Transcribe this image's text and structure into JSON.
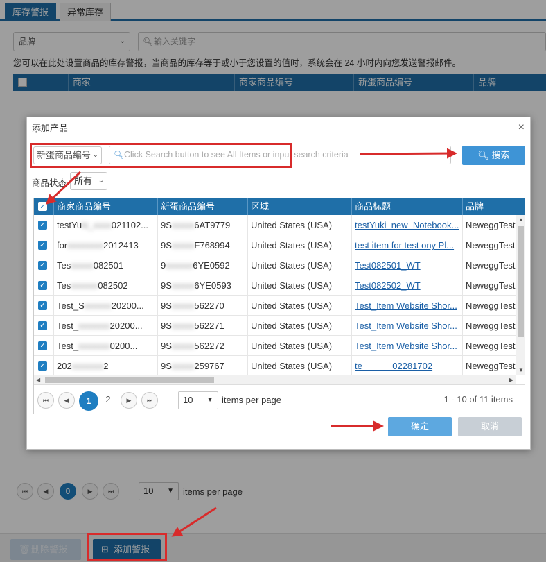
{
  "tabs": [
    {
      "label": "库存警报",
      "active": true
    },
    {
      "label": "异常库存",
      "active": false
    }
  ],
  "filter": {
    "brand_select": "品牌",
    "search_placeholder": "输入关键字"
  },
  "notice": "您可以在此处设置商品的库存警报，当商品的库存等于或小于您设置的值时，系统会在 24 小时内向您发送警报邮件。",
  "bg_table": {
    "columns": [
      "商家",
      "商家商品编号",
      "新蛋商品编号",
      "品牌"
    ]
  },
  "bg_pager": {
    "first": "⏮",
    "prev": "◀",
    "current": "0",
    "next": "▶",
    "last": "⏭",
    "page_size": "10",
    "items_per_page": "items per page"
  },
  "actions": {
    "delete_label": "删除警报",
    "add_label": "添加警报"
  },
  "modal": {
    "title": "添加产品",
    "close": "×",
    "field_select": "新蛋商品编号",
    "search_placeholder": "Click Search button to see All Items or input search criteria",
    "search_button": "搜索",
    "status_label": "商品状态",
    "status_value": "所有",
    "columns": [
      "商家商品编号",
      "新蛋商品编号",
      "区域",
      "商品标题",
      "品牌"
    ],
    "rows": [
      {
        "seller_prefix": "testYu",
        "seller_mid": "ki_xxxx",
        "seller_suffix": "021102...",
        "ne_prefix": "9S",
        "ne_mid": "xxxxx",
        "ne_suffix": "6AT9779",
        "region": "United States (USA)",
        "title": "testYuki_new_Notebook...",
        "brand": "NeweggTest"
      },
      {
        "seller_prefix": "for",
        "seller_mid": "xxxxxxxx",
        "seller_suffix": "2012413",
        "ne_prefix": "9S",
        "ne_mid": "xxxxx",
        "ne_suffix": "F768994",
        "region": "United States (USA)",
        "title": "test item for test ony Pl...",
        "brand": "NeweggTest"
      },
      {
        "seller_prefix": "Tes",
        "seller_mid": "xxxxx",
        "seller_suffix": "082501",
        "ne_prefix": "9",
        "ne_mid": "xxxxxx",
        "ne_suffix": "6YE0592",
        "region": "United States (USA)",
        "title": "Test082501_WT",
        "brand": "NeweggTest"
      },
      {
        "seller_prefix": "Tes",
        "seller_mid": "xxxxxx",
        "seller_suffix": "082502",
        "ne_prefix": "9S",
        "ne_mid": "xxxxx",
        "ne_suffix": "6YE0593",
        "region": "United States (USA)",
        "title": "Test082502_WT",
        "brand": "NeweggTest"
      },
      {
        "seller_prefix": "Test_S",
        "seller_mid": "xxxxxx",
        "seller_suffix": "20200...",
        "ne_prefix": "9S",
        "ne_mid": "xxxxx",
        "ne_suffix": "562270",
        "region": "United States (USA)",
        "title": "Test_Item Website Shor...",
        "brand": "NeweggTest"
      },
      {
        "seller_prefix": "Test_",
        "seller_mid": "xxxxxxx",
        "seller_suffix": "20200...",
        "ne_prefix": "9S",
        "ne_mid": "xxxxx",
        "ne_suffix": "562271",
        "region": "United States (USA)",
        "title": "Test_Item Website Shor...",
        "brand": "NeweggTest"
      },
      {
        "seller_prefix": "Test_",
        "seller_mid": "xxxxxxx",
        "seller_suffix": "0200...",
        "ne_prefix": "9S",
        "ne_mid": "xxxxx",
        "ne_suffix": "562272",
        "region": "United States (USA)",
        "title": "Test_Item Website Shor...",
        "brand": "NeweggTest"
      },
      {
        "seller_prefix": "202",
        "seller_mid": "xxxxxxx",
        "seller_suffix": "2",
        "ne_prefix": "9S",
        "ne_mid": "xxxxx",
        "ne_suffix": "259767",
        "region": "United States (USA)",
        "title": "te______02281702",
        "brand": "NeweggTest"
      }
    ],
    "pager": {
      "first": "⏮",
      "prev": "◀",
      "page1": "1",
      "page2": "2",
      "next": "▶",
      "last": "⏭",
      "page_size": "10",
      "items_per_page": "items per page",
      "count": "1 - 10 of 11 items"
    },
    "ok_button": "确定",
    "cancel_button": "取消"
  },
  "colors": {
    "primary": "#1f6fa8",
    "accent": "#3e94d6",
    "annotation": "#d82b2b"
  }
}
